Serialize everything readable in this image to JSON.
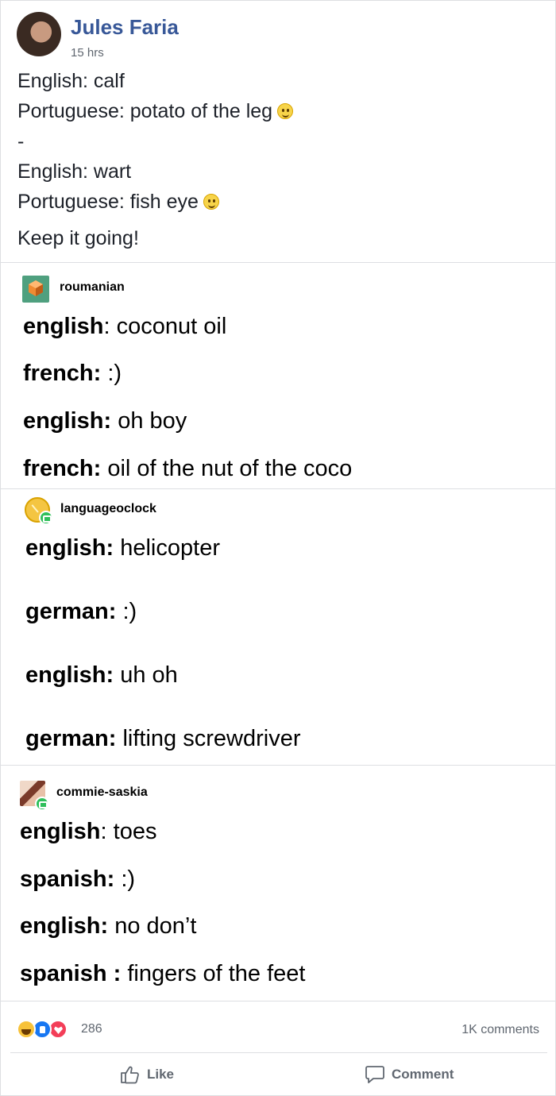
{
  "post": {
    "author": "Jules Faria",
    "timestamp": "15 hrs",
    "lines": [
      "English: calf",
      "Portuguese: potato of the leg",
      "-",
      "English: wart",
      "Portuguese: fish eye",
      "Keep it going!"
    ]
  },
  "tumblr": [
    {
      "username": "roumanian",
      "avatar_icon": "cube-avatar-icon",
      "lines": [
        {
          "label": "english",
          "sep": ": ",
          "text": "coconut oil"
        },
        {
          "label": "french:",
          "sep": " ",
          "text": ":)"
        },
        {
          "label": "english:",
          "sep": " ",
          "text": "oh boy"
        },
        {
          "label": "french:",
          "sep": " ",
          "text": "oil of the nut of the coco"
        }
      ]
    },
    {
      "username": "languageoclock",
      "avatar_icon": "clock-avatar-icon",
      "lines": [
        {
          "label": "english:",
          "sep": " ",
          "text": "helicopter"
        },
        {
          "label": "german:",
          "sep": " ",
          "text": ":)"
        },
        {
          "label": "english:",
          "sep": " ",
          "text": "uh oh"
        },
        {
          "label": "german:",
          "sep": " ",
          "text": "lifting screwdriver"
        }
      ]
    },
    {
      "username": "commie-saskia",
      "avatar_icon": "photo-avatar-icon",
      "lines": [
        {
          "label": "english",
          "sep": ": ",
          "text": "toes"
        },
        {
          "label": "spanish:",
          "sep": " ",
          "text": ":)"
        },
        {
          "label": "english:",
          "sep": " ",
          "text": "no don’t"
        },
        {
          "label": "spanish :",
          "sep": " ",
          "text": "fingers of the feet"
        }
      ]
    }
  ],
  "footer": {
    "reaction_count": "286",
    "comments_count": "1K comments",
    "like_label": "Like",
    "comment_label": "Comment"
  },
  "colors": {
    "author": "#385898",
    "meta": "#606770",
    "divider": "#dddfe2"
  }
}
